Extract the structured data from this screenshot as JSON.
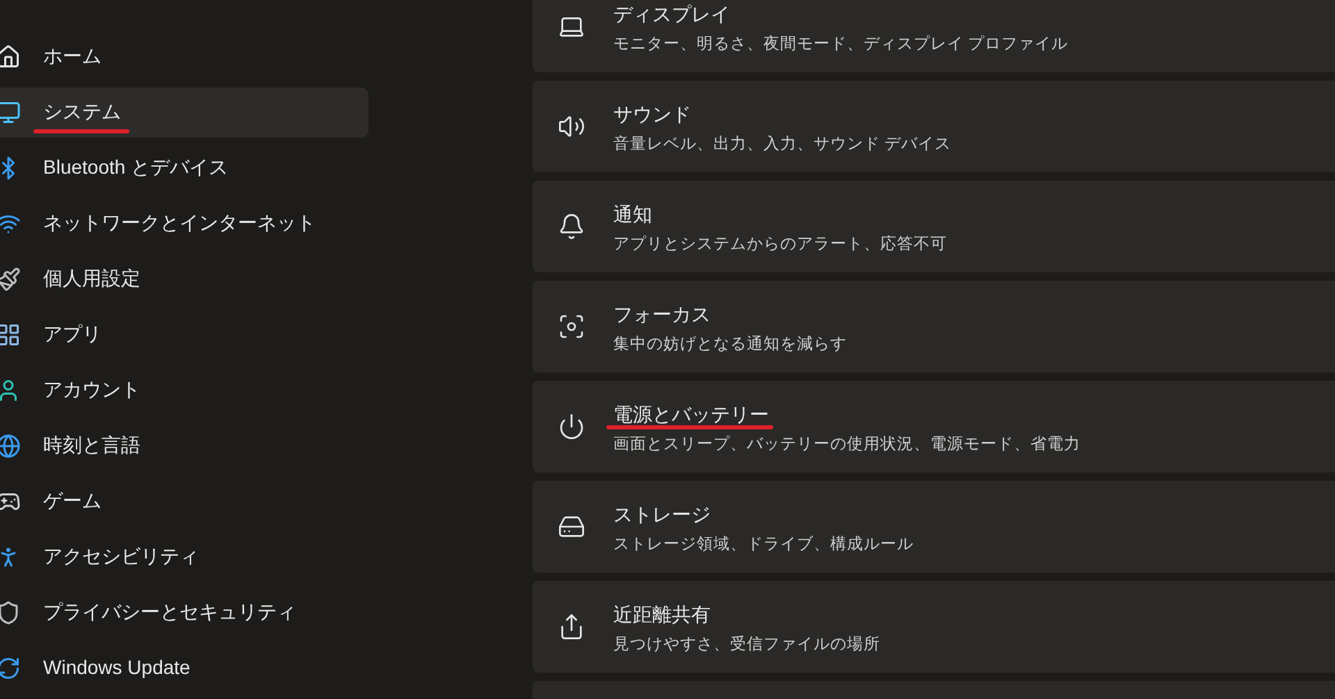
{
  "sidebar": {
    "items": [
      {
        "kind": "home",
        "label": "ホーム",
        "selected": false,
        "highlighted": false
      },
      {
        "kind": "system",
        "label": "システム",
        "selected": true,
        "highlighted": true
      },
      {
        "kind": "bluetooth",
        "label": "Bluetooth とデバイス",
        "selected": false,
        "highlighted": false
      },
      {
        "kind": "network",
        "label": "ネットワークとインターネット",
        "selected": false,
        "highlighted": false
      },
      {
        "kind": "personalize",
        "label": "個人用設定",
        "selected": false,
        "highlighted": false
      },
      {
        "kind": "apps",
        "label": "アプリ",
        "selected": false,
        "highlighted": false
      },
      {
        "kind": "account",
        "label": "アカウント",
        "selected": false,
        "highlighted": false
      },
      {
        "kind": "time",
        "label": "時刻と言語",
        "selected": false,
        "highlighted": false
      },
      {
        "kind": "game",
        "label": "ゲーム",
        "selected": false,
        "highlighted": false
      },
      {
        "kind": "accessibility",
        "label": "アクセシビリティ",
        "selected": false,
        "highlighted": false
      },
      {
        "kind": "privacy",
        "label": "プライバシーとセキュリティ",
        "selected": false,
        "highlighted": false
      },
      {
        "kind": "update",
        "label": "Windows Update",
        "selected": false,
        "highlighted": false
      }
    ]
  },
  "settings": [
    {
      "kind": "display",
      "title": "ディスプレイ",
      "description": "モニター、明るさ、夜間モード、ディスプレイ プロファイル",
      "highlighted": false
    },
    {
      "kind": "sound",
      "title": "サウンド",
      "description": "音量レベル、出力、入力、サウンド デバイス",
      "highlighted": false
    },
    {
      "kind": "notifications",
      "title": "通知",
      "description": "アプリとシステムからのアラート、応答不可",
      "highlighted": false
    },
    {
      "kind": "focus",
      "title": "フォーカス",
      "description": "集中の妨げとなる通知を減らす",
      "highlighted": false
    },
    {
      "kind": "power",
      "title": "電源とバッテリー",
      "description": "画面とスリープ、バッテリーの使用状況、電源モード、省電力",
      "highlighted": true
    },
    {
      "kind": "storage",
      "title": "ストレージ",
      "description": "ストレージ領域、ドライブ、構成ルール",
      "highlighted": false
    },
    {
      "kind": "nearby",
      "title": "近距離共有",
      "description": "見つけやすさ、受信ファイルの場所",
      "highlighted": false
    },
    {
      "kind": "empty"
    }
  ]
}
